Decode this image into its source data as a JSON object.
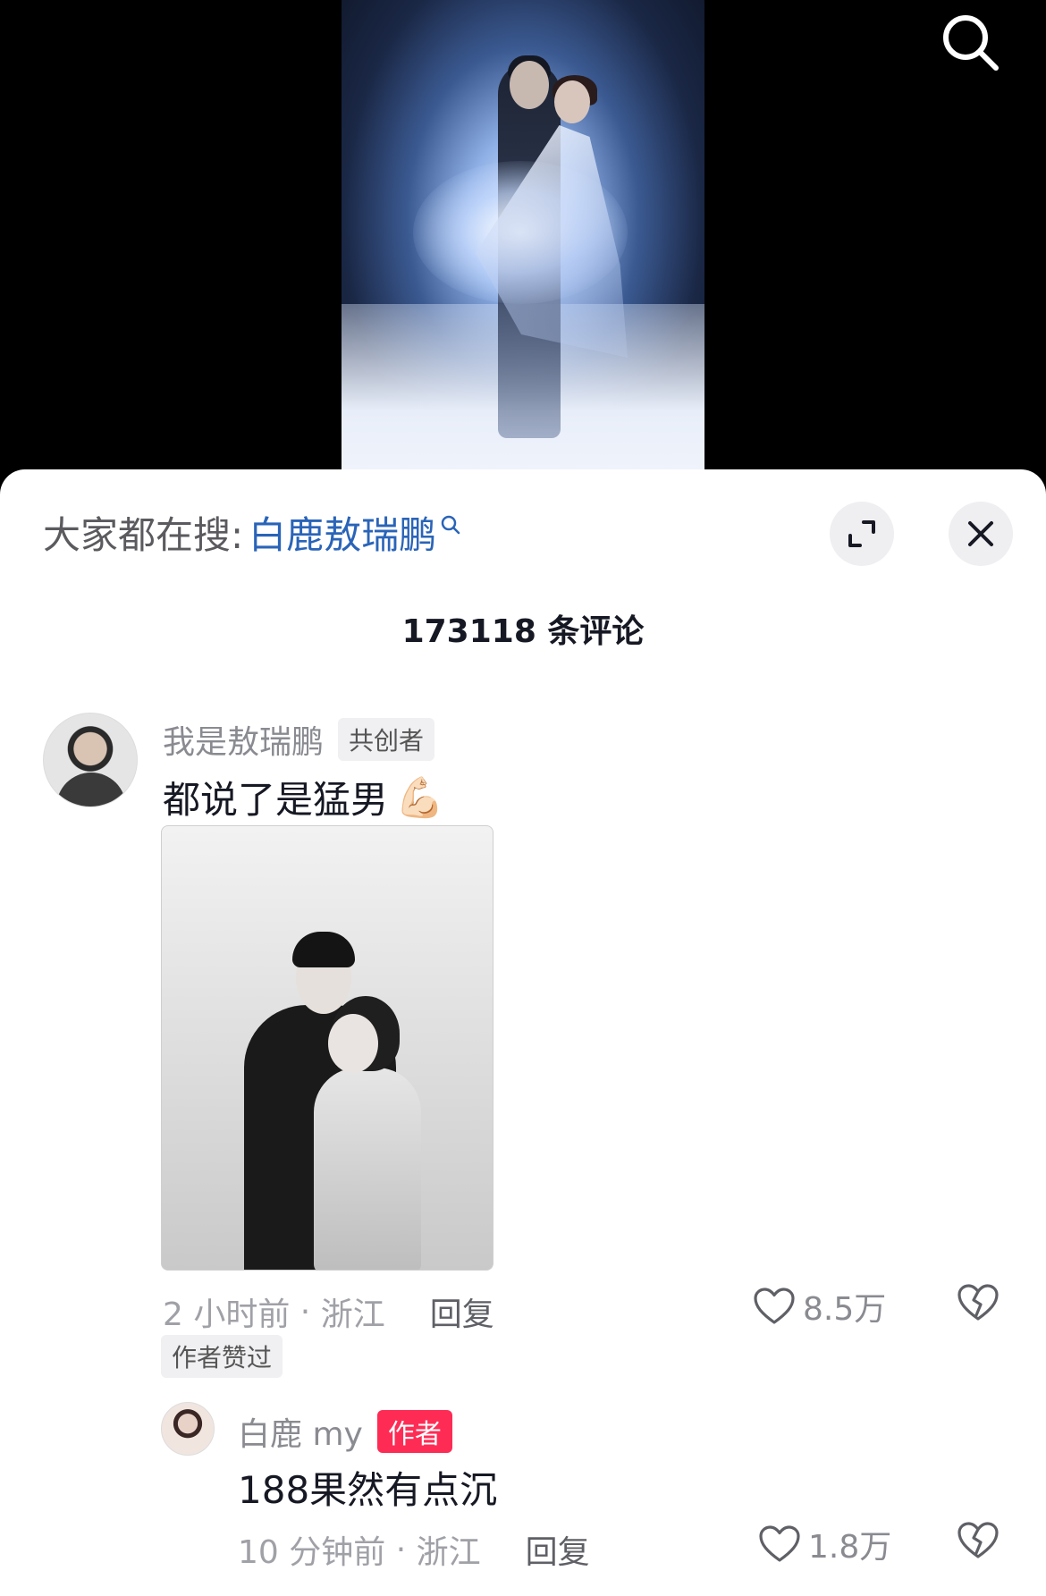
{
  "video": {
    "search_icon": "search-icon"
  },
  "header": {
    "trending_label": "大家都在搜:",
    "trending_query": "白鹿敖瑞鹏",
    "expand_icon": "expand-icon",
    "close_icon": "close-icon"
  },
  "comment_count": "173118 条评论",
  "comments": [
    {
      "username": "我是敖瑞鹏",
      "badge": "共创者",
      "text": "都说了是猛男",
      "emoji": "💪🏻",
      "time": "2 小时前",
      "location": "浙江",
      "reply_label": "回复",
      "likes": "8.5万",
      "author_liked": "作者赞过"
    },
    {
      "username": "白鹿 my",
      "badge": "作者",
      "text": "188果然有点沉",
      "time": "10 分钟前",
      "location": "浙江",
      "reply_label": "回复",
      "likes": "1.8万"
    }
  ],
  "colors": {
    "link_blue": "#2a64b8",
    "author_badge": "#fe2c55",
    "text_primary": "#161823",
    "text_secondary": "#a0a1a7"
  }
}
